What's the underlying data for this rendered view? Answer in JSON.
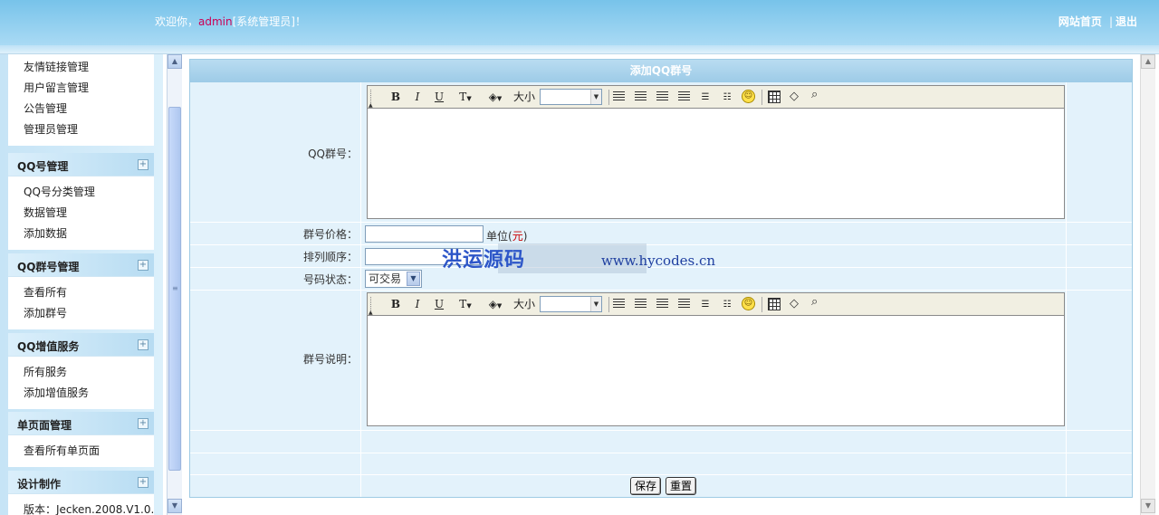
{
  "header": {
    "welcome_prefix": "欢迎你，",
    "username": "admin",
    "role_suffix": "[系统管理员]！",
    "link_home": "网站首页",
    "link_logout": "退出"
  },
  "sidebar": {
    "top_items": [
      "友情链接管理",
      "用户留言管理",
      "公告管理",
      "管理员管理"
    ],
    "groups": [
      {
        "title": "QQ号管理",
        "items": [
          "QQ号分类管理",
          "数据管理",
          "添加数据"
        ]
      },
      {
        "title": "QQ群号管理",
        "items": [
          "查看所有",
          "添加群号"
        ]
      },
      {
        "title": "QQ增值服务",
        "items": [
          "所有服务",
          "添加增值服务"
        ]
      },
      {
        "title": "单页面管理",
        "items": [
          "查看所有单页面"
        ]
      },
      {
        "title": "设计制作",
        "items": [
          "版本：Jecken.2008.V1.0."
        ]
      }
    ]
  },
  "form": {
    "title": "添加QQ群号",
    "labels": {
      "qq_group": "QQ群号：",
      "price": "群号价格：",
      "order": "排列顺序：",
      "status": "号码状态：",
      "description": "群号说明："
    },
    "price_unit_prefix": "单位(",
    "price_unit_currency": "元",
    "price_unit_suffix": ")",
    "price_value": "",
    "order_value": "",
    "status_selected": "可交易",
    "editor_fontsize_label": "大小",
    "save_label": "保存",
    "reset_label": "重置"
  },
  "watermark": {
    "text": "洪运源码",
    "url": "www.hycodes.cn"
  },
  "colors": {
    "header": "#77c3ea",
    "form_bg": "#e3f2fb",
    "form_title": "#9dcbe7",
    "accent_red": "#cc0000"
  }
}
